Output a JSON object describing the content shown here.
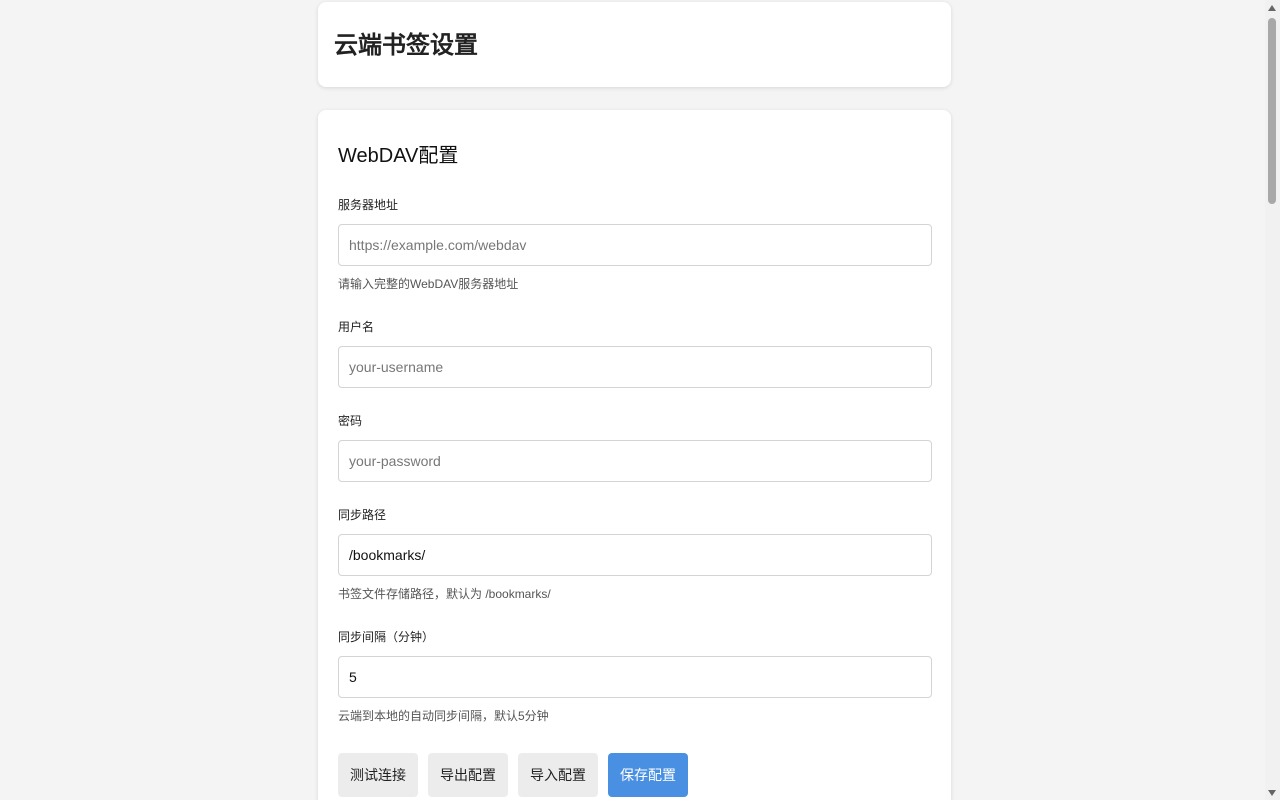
{
  "header": {
    "title": "云端书签设置"
  },
  "webdav": {
    "section_title": "WebDAV配置",
    "server": {
      "label": "服务器地址",
      "placeholder": "https://example.com/webdav",
      "value": "",
      "hint": "请输入完整的WebDAV服务器地址"
    },
    "username": {
      "label": "用户名",
      "placeholder": "your-username",
      "value": ""
    },
    "password": {
      "label": "密码",
      "placeholder": "your-password",
      "value": ""
    },
    "sync_path": {
      "label": "同步路径",
      "placeholder": "",
      "value": "/bookmarks/",
      "hint": "书签文件存储路径，默认为 /bookmarks/"
    },
    "sync_interval": {
      "label": "同步间隔（分钟）",
      "placeholder": "",
      "value": "5",
      "hint": "云端到本地的自动同步间隔，默认5分钟"
    }
  },
  "buttons": {
    "test": "测试连接",
    "export": "导出配置",
    "import": "导入配置",
    "save": "保存配置"
  },
  "colors": {
    "primary": "#4a90e2",
    "background": "#f4f4f4",
    "secondary_button": "#ececec"
  }
}
